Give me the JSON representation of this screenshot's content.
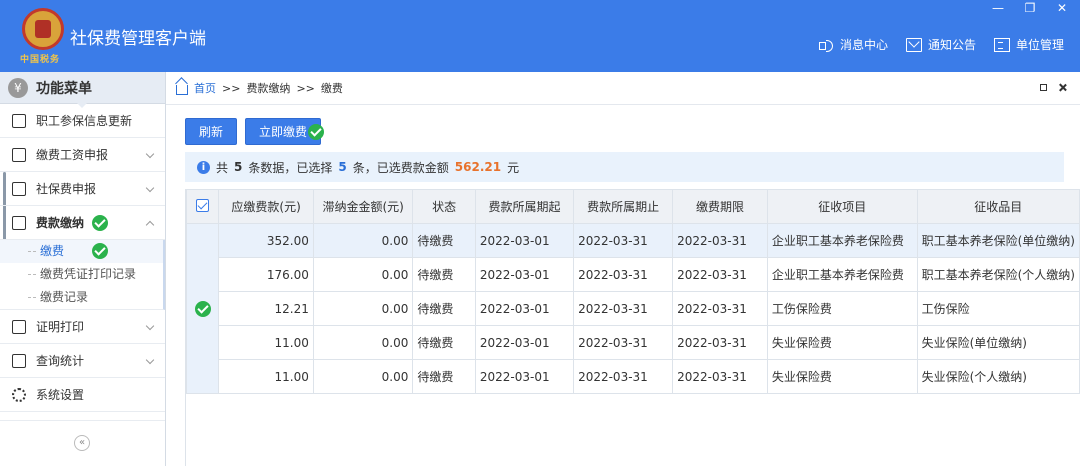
{
  "app": {
    "title": "社保费管理客户端",
    "logo_sub": "中国税务",
    "window_controls": [
      "—",
      "❐",
      "✕"
    ]
  },
  "top_nav": [
    {
      "label": "消息中心",
      "icon": "speaker-icon"
    },
    {
      "label": "通知公告",
      "icon": "mail-icon"
    },
    {
      "label": "单位管理",
      "icon": "building-icon"
    }
  ],
  "sidebar": {
    "header_icon": "¥",
    "header_title": "功能菜单",
    "items": [
      {
        "label": "职工参保信息更新",
        "icon": "list-icon",
        "has_chevron": false
      },
      {
        "label": "缴费工资申报",
        "icon": "edit-icon",
        "has_chevron": true
      },
      {
        "label": "社保费申报",
        "icon": "form-icon",
        "has_chevron": true
      },
      {
        "label": "费款缴纳",
        "icon": "book-icon",
        "has_chevron": true,
        "expanded": true
      },
      {
        "label": "证明打印",
        "icon": "print-icon",
        "has_chevron": true
      },
      {
        "label": "查询统计",
        "icon": "chart-icon",
        "has_chevron": true
      },
      {
        "label": "系统设置",
        "icon": "gear-icon",
        "has_chevron": false
      }
    ],
    "sub_items": [
      {
        "label": "缴费",
        "active": true
      },
      {
        "label": "缴费凭证打印记录",
        "active": false
      },
      {
        "label": "缴费记录",
        "active": false
      }
    ],
    "collapse_label": "«"
  },
  "breadcrumb": {
    "home": "首页",
    "sep": ">>",
    "level1": "费款缴纳",
    "level2": "缴费"
  },
  "toolbar": {
    "refresh_label": "刷新",
    "pay_now_label": "立即缴费"
  },
  "summary": {
    "prefix": "共",
    "total": "5",
    "mid1": "条数据，已选择",
    "selected": "5",
    "mid2": "条，已选费款金额",
    "amount": "562.21",
    "unit": "元"
  },
  "table": {
    "columns": [
      "应缴费款(元)",
      "滞纳金金额(元)",
      "状态",
      "费款所属期起",
      "费款所属期止",
      "缴费期限",
      "征收项目",
      "征收品目"
    ],
    "rows": [
      [
        "352.00",
        "0.00",
        "待缴费",
        "2022-03-01",
        "2022-03-31",
        "2022-03-31",
        "企业职工基本养老保险费",
        "职工基本养老保险(单位缴纳)"
      ],
      [
        "176.00",
        "0.00",
        "待缴费",
        "2022-03-01",
        "2022-03-31",
        "2022-03-31",
        "企业职工基本养老保险费",
        "职工基本养老保险(个人缴纳)"
      ],
      [
        "12.21",
        "0.00",
        "待缴费",
        "2022-03-01",
        "2022-03-31",
        "2022-03-31",
        "工伤保险费",
        "工伤保险"
      ],
      [
        "11.00",
        "0.00",
        "待缴费",
        "2022-03-01",
        "2022-03-31",
        "2022-03-31",
        "失业保险费",
        "失业保险(单位缴纳)"
      ],
      [
        "11.00",
        "0.00",
        "待缴费",
        "2022-03-01",
        "2022-03-31",
        "2022-03-31",
        "失业保险费",
        "失业保险(个人缴纳)"
      ]
    ]
  },
  "colors": {
    "header_blue": "#3b7ce8",
    "link_blue": "#2a6fd6",
    "amount_orange": "#e8722c",
    "check_green": "#2bb24c"
  }
}
